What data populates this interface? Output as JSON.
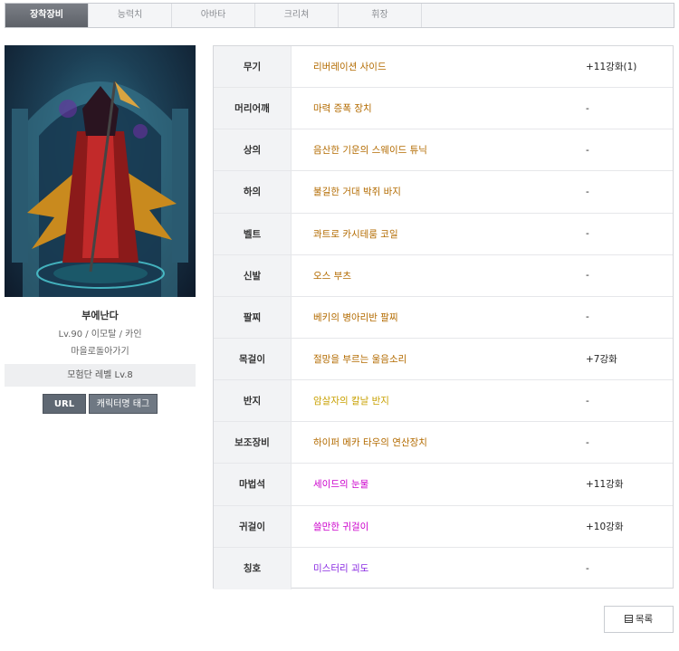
{
  "tabs": [
    "장착장비",
    "능력치",
    "아바타",
    "크리쳐",
    "휘장"
  ],
  "character": {
    "name": "부에난다",
    "info": "Lv.90 / 이모탈 / 카인",
    "guild": "마을로돌아가기",
    "adventure_level": "모험단 레벨 Lv.8",
    "url_label": "URL",
    "tag_label": "캐릭터명 태그"
  },
  "equipment": [
    {
      "slot": "무기",
      "item": "리버레이션 사이드",
      "enhance": "+11강화(1)",
      "color": "#b36b00"
    },
    {
      "slot": "머리어깨",
      "item": "마력 증폭 장치",
      "enhance": "-",
      "color": "#b36b00"
    },
    {
      "slot": "상의",
      "item": "음산한 기운의 스웨이드 튜닉",
      "enhance": "-",
      "color": "#b36b00"
    },
    {
      "slot": "하의",
      "item": "불길한 거대 박쥐 바지",
      "enhance": "-",
      "color": "#b36b00"
    },
    {
      "slot": "벨트",
      "item": "콰트로 카시테룸 코일",
      "enhance": "-",
      "color": "#b36b00"
    },
    {
      "slot": "신발",
      "item": "오스 부츠",
      "enhance": "-",
      "color": "#b36b00"
    },
    {
      "slot": "팔찌",
      "item": "베키의 병아리반 팔찌",
      "enhance": "-",
      "color": "#b36b00"
    },
    {
      "slot": "목걸이",
      "item": "절망을 부르는 울음소리",
      "enhance": "+7강화",
      "color": "#b36b00"
    },
    {
      "slot": "반지",
      "item": "암살자의 칼날 반지",
      "enhance": "-",
      "color": "#c8a000"
    },
    {
      "slot": "보조장비",
      "item": "하이퍼 메카 타우의 연산장치",
      "enhance": "-",
      "color": "#b36b00"
    },
    {
      "slot": "마법석",
      "item": "세이드의 눈물",
      "enhance": "+11강화",
      "color": "#cc00cc"
    },
    {
      "slot": "귀걸이",
      "item": "쓸만한 귀걸이",
      "enhance": "+10강화",
      "color": "#cc00cc"
    },
    {
      "slot": "칭호",
      "item": "미스터리 괴도",
      "enhance": "-",
      "color": "#8a2be2"
    }
  ],
  "list_button": "목록"
}
